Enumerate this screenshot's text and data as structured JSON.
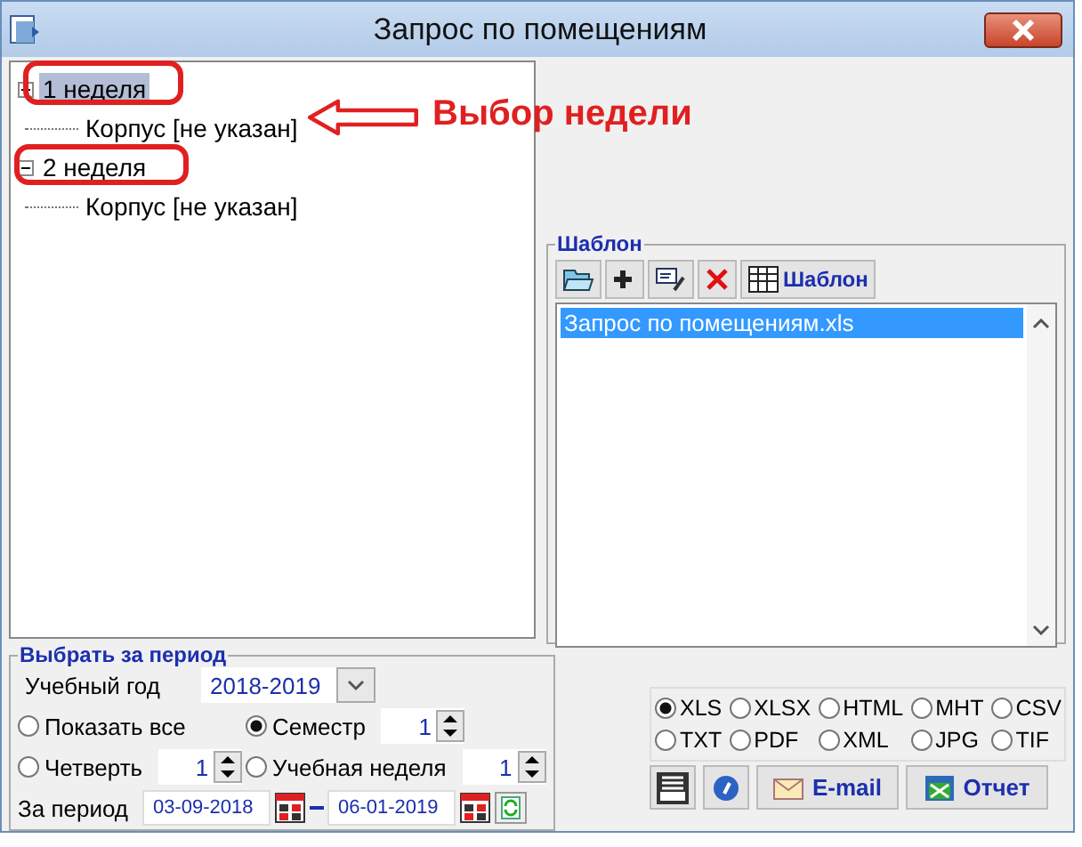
{
  "window": {
    "title": "Запрос по помещениям"
  },
  "tree": [
    {
      "label": "1 неделя",
      "selected": true,
      "expanded": true,
      "children": [
        {
          "label": "Корпус [не указан]"
        }
      ]
    },
    {
      "label": "2 неделя",
      "selected": false,
      "expanded": true,
      "children": [
        {
          "label": "Корпус [не указан]"
        }
      ]
    }
  ],
  "annotation": {
    "text": "Выбор недели"
  },
  "template": {
    "title": "Шаблон",
    "toolbar_button": "Шаблон",
    "files": [
      {
        "label": "Запрос по помещениям.xls",
        "selected": true
      }
    ]
  },
  "period": {
    "title": "Выбрать за период",
    "year_label": "Учебный год",
    "year": "2018-2019",
    "options": [
      {
        "label": "Показать все",
        "selected": false
      },
      {
        "label": "Семестр",
        "selected": true,
        "value": "1"
      },
      {
        "label": "Четверть",
        "selected": false,
        "value": "1"
      },
      {
        "label": "Учебная неделя",
        "selected": false,
        "value": "1"
      }
    ],
    "range_label": "За период",
    "from": "03-09-2018",
    "to": "06-01-2019"
  },
  "formats": [
    {
      "label": "XLS",
      "selected": true
    },
    {
      "label": "XLSX",
      "selected": false
    },
    {
      "label": "HTML",
      "selected": false
    },
    {
      "label": "MHT",
      "selected": false
    },
    {
      "label": "CSV",
      "selected": false
    },
    {
      "label": "TXT",
      "selected": false
    },
    {
      "label": "PDF",
      "selected": false
    },
    {
      "label": "XML",
      "selected": false
    },
    {
      "label": "JPG",
      "selected": false
    },
    {
      "label": "TIF",
      "selected": false
    }
  ],
  "buttons": [
    "E-mail",
    "Отчет"
  ]
}
